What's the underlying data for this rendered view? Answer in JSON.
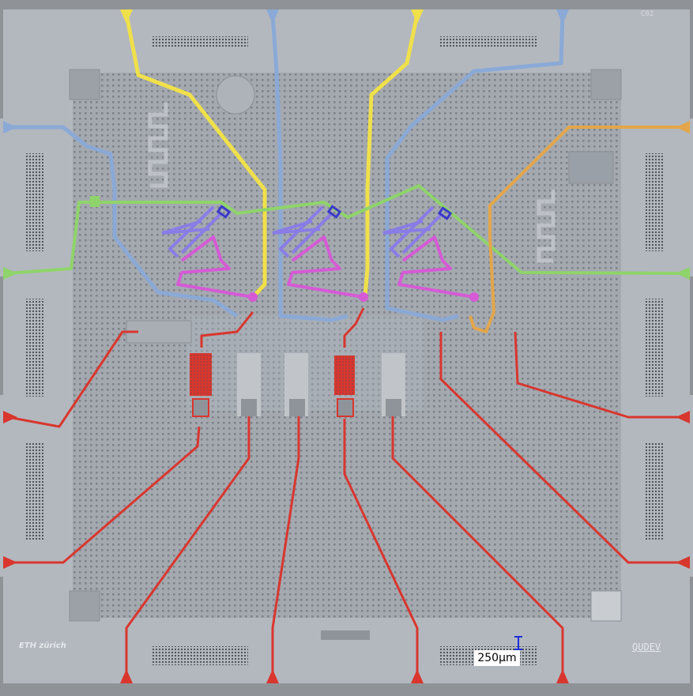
{
  "image": {
    "chip_id": "C02",
    "logo_left": "ETH zürich",
    "logo_right": "QUDEV",
    "scale_bar_label": "250µm"
  },
  "colors": {
    "frame": "#8f9398",
    "chip": "#b3b8bf",
    "ground_plane": "#a4a9b0",
    "via_dots": "#7e838a",
    "readout_blue": "#8aa9d6",
    "flux_yellow": "#f0e04a",
    "feedline_green": "#8fd46a",
    "resonator_violet": "#8a7ce6",
    "purcell_magenta": "#d65ad6",
    "drive_red": "#d9362e",
    "aux_orange": "#e3a64a",
    "scale_blue": "#1d2fd6"
  }
}
